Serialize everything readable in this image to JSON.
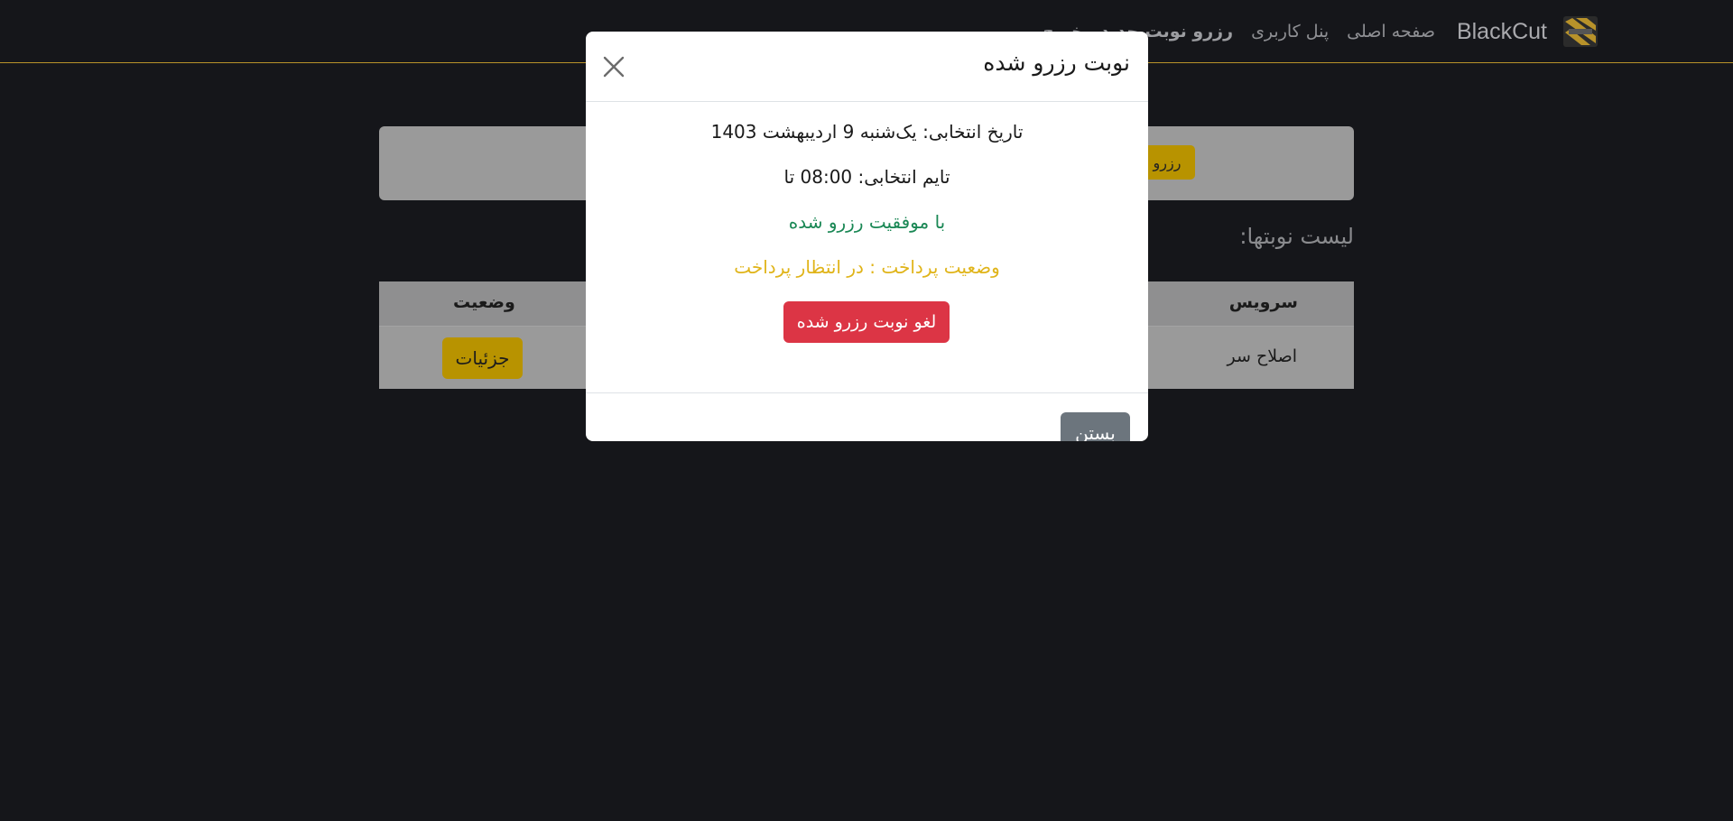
{
  "navbar": {
    "brand": "BlackCut",
    "links": [
      "صفحه اصلی",
      "پنل کاربری",
      "رزرو نوبت جدید",
      "خروج"
    ],
    "active_index": 2,
    "accent_color": "#b8922a"
  },
  "page": {
    "reserve_button_label": "رزرو",
    "list_title": "لیست نوبتها:",
    "table": {
      "headers": {
        "service": "سرویس",
        "status": "وضعیت"
      },
      "rows": [
        {
          "service": "اصلاح سر",
          "action": "جزئیات"
        }
      ]
    }
  },
  "modal": {
    "title": "نوبت رزرو شده",
    "date_line": "تاریخ انتخابی: یک‌شنبه 9 اردیبهشت 1403",
    "time_line": "تایم انتخابی: 08:00 تا",
    "success_text": "با موفقیت رزرو شده",
    "payment_status": "وضعیت پرداخت : در انتظار پرداخت",
    "cancel_label": "لغو نوبت رزرو شده",
    "close_label": "بستن",
    "colors": {
      "success": "#198754",
      "warning": "#e0b419",
      "danger": "#dc3545",
      "secondary": "#6c757d"
    }
  }
}
